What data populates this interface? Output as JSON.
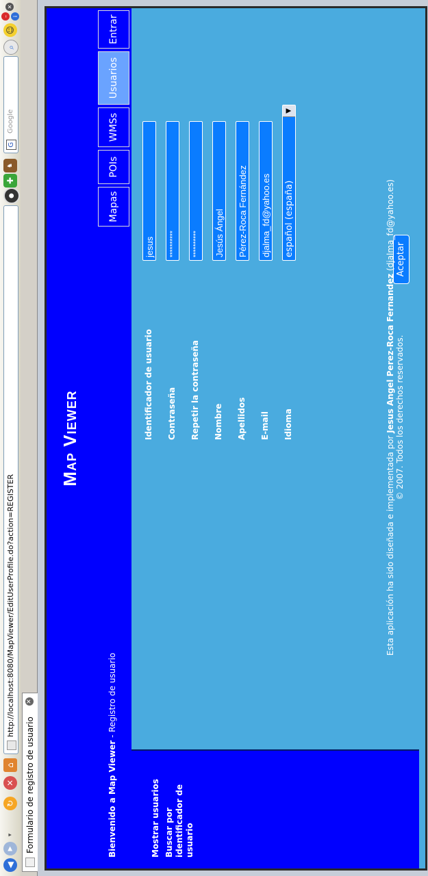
{
  "browser": {
    "url": "http://localhost:8080/MapViewer/EditUserProfile.do?action=REGISTER",
    "search_placeholder": "Google",
    "tab_title": "Formulario de registro de usuario"
  },
  "header": {
    "title": "Map Viewer"
  },
  "navbar": {
    "welcome_bold": "Bienvenido a Map Viewer",
    "welcome_rest": " - Registro de usuario",
    "tabs": [
      {
        "label": "Mapas"
      },
      {
        "label": "POIs"
      },
      {
        "label": "WMSs"
      },
      {
        "label": "Usuarios"
      },
      {
        "label": "Entrar"
      }
    ],
    "active_tab": "Usuarios"
  },
  "sidebar": {
    "items": [
      {
        "label": "Mostrar usuarios"
      },
      {
        "label": "Buscar por identificador de usuario"
      }
    ]
  },
  "form": {
    "fields": [
      {
        "label": "Identificador de usuario",
        "value": "jesus"
      },
      {
        "label": "Contraseña",
        "value": "**********"
      },
      {
        "label": "Repetir la contraseña",
        "value": "**********"
      },
      {
        "label": "Nombre",
        "value": "Jesús Ángel"
      },
      {
        "label": "Apellidos",
        "value": "Pérez-Roca Fernández"
      },
      {
        "label": "E-mail",
        "value": "djalma_fd@yahoo.es"
      },
      {
        "label": "Idioma",
        "value": "español (españa)"
      }
    ],
    "submit_label": "Aceptar"
  },
  "footer": {
    "line1_prefix": "Esta aplicación ha sido diseñada e implementada por ",
    "line1_author": "Jesus Angel Perez-Roca Fernandez",
    "line1_suffix": " (djalma_fd@yahoo.es)",
    "line2": "© 2007. Todos los derechos reservados."
  },
  "colors": {
    "header_bg": "#0000ff",
    "content_bg": "#4aabdf",
    "input_bg": "#0a7cff"
  }
}
